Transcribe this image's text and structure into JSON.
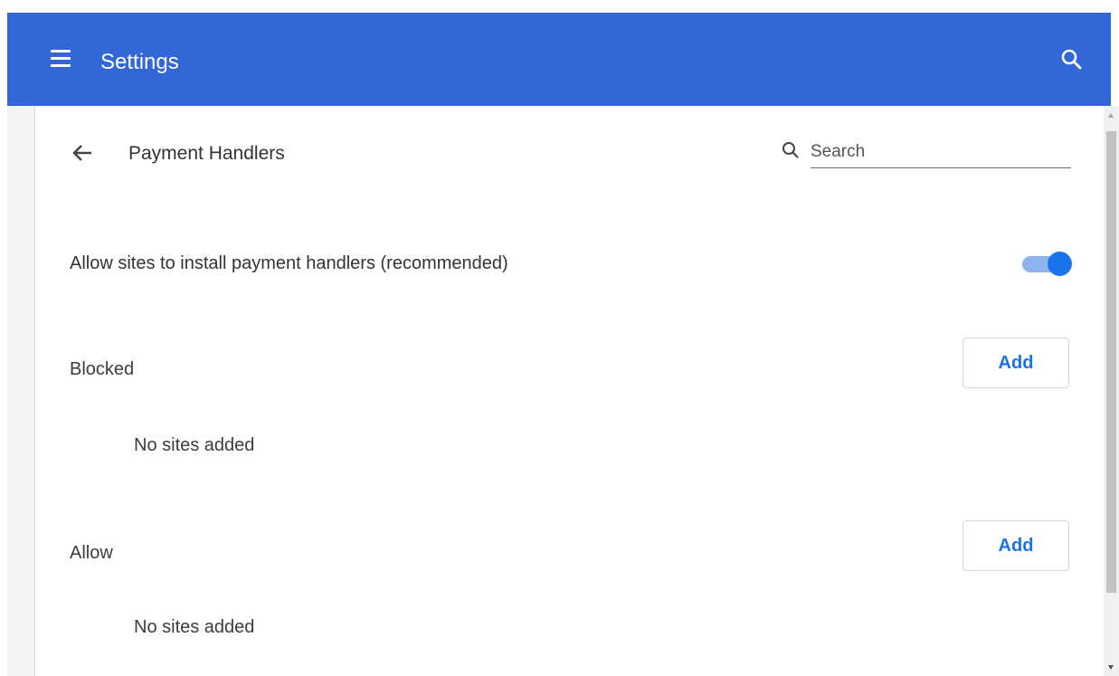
{
  "header": {
    "title": "Settings",
    "menu_icon": "hamburger-menu-icon",
    "search_icon": "search-icon",
    "background_color": "#3367d6"
  },
  "page": {
    "title": "Payment Handlers",
    "back_icon": "arrow-back-icon",
    "search": {
      "placeholder": "Search",
      "value": ""
    }
  },
  "setting": {
    "label": "Allow sites to install payment handlers (recommended)",
    "enabled": true,
    "accent_color": "#1a73e8"
  },
  "sections": {
    "blocked": {
      "label": "Blocked",
      "add_label": "Add",
      "empty_text": "No sites added"
    },
    "allow": {
      "label": "Allow",
      "add_label": "Add",
      "empty_text": "No sites added"
    }
  }
}
